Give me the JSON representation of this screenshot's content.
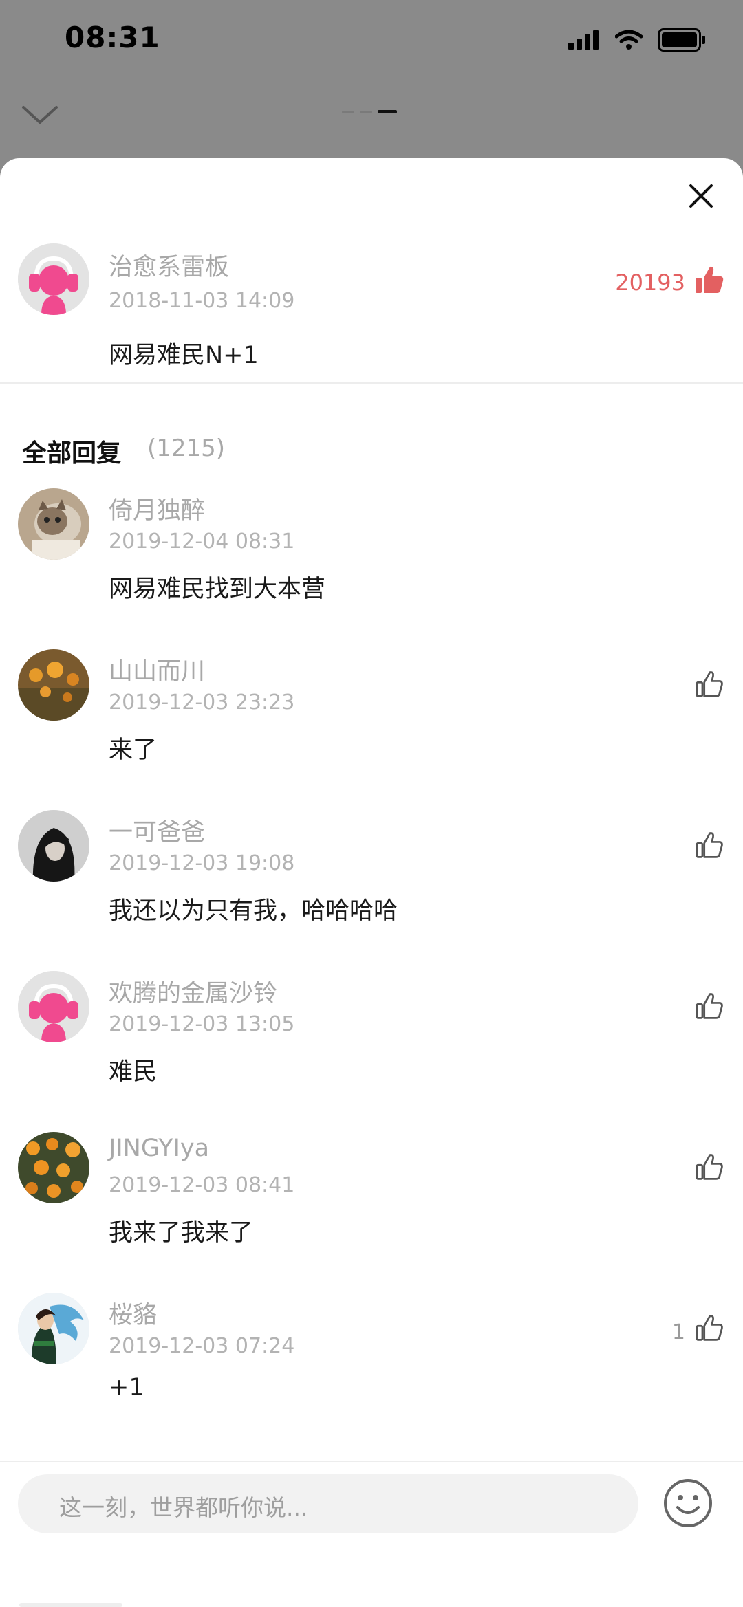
{
  "status_bar": {
    "time": "08:31"
  },
  "original_comment": {
    "user": "治愈系雷板",
    "date": "2018-11-03 14:09",
    "content": "网易难民N+1",
    "likes": "20193"
  },
  "replies_header": {
    "title": "全部回复",
    "count": "(1215)"
  },
  "replies": [
    {
      "user": "倚月独醉",
      "date": "2019-12-04 08:31",
      "content": "网易难民找到大本营",
      "likes": ""
    },
    {
      "user": "山山而川",
      "date": "2019-12-03 23:23",
      "content": "来了",
      "likes": ""
    },
    {
      "user": "一可爸爸",
      "date": "2019-12-03 19:08",
      "content": "我还以为只有我，哈哈哈哈",
      "likes": ""
    },
    {
      "user": "欢腾的金属沙铃",
      "date": "2019-12-03 13:05",
      "content": "难民",
      "likes": ""
    },
    {
      "user": "JINGYIya",
      "date": "2019-12-03 08:41",
      "content": "我来了我来了",
      "likes": ""
    },
    {
      "user": "桜貉",
      "date": "2019-12-03 07:24",
      "content": "+1",
      "likes": "1"
    }
  ],
  "composer": {
    "placeholder": "这一刻，世界都听你说..."
  },
  "colors": {
    "accent_red": "#e36061",
    "sheet_bg": "#ffffff",
    "backdrop": "#8a8a8a"
  },
  "icons": [
    "signal-icon",
    "wifi-icon",
    "battery-icon",
    "chevron-down-icon",
    "close-icon",
    "thumbs-up-icon",
    "emoji-icon"
  ]
}
